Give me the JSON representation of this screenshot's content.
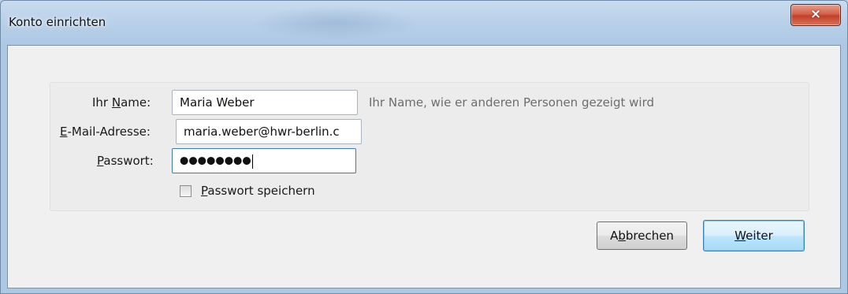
{
  "window": {
    "title": "Konto einrichten",
    "close_glyph": "×"
  },
  "form": {
    "name": {
      "label_pre": "Ihr ",
      "label_mnemonic": "N",
      "label_post": "ame:",
      "value": "Maria Weber",
      "hint": "Ihr Name, wie er anderen Personen gezeigt wird"
    },
    "email": {
      "label_mnemonic": "E",
      "label_post": "-Mail-Adresse:",
      "value": "maria.weber@hwr-berlin.c"
    },
    "password": {
      "label_mnemonic": "P",
      "label_post": "asswort:",
      "masked_value": "●●●●●●●●"
    },
    "remember": {
      "label_mnemonic": "P",
      "label_post": "asswort speichern",
      "checked": false
    }
  },
  "buttons": {
    "cancel": {
      "label_pre": "A",
      "label_mnemonic": "b",
      "label_post": "brechen"
    },
    "next": {
      "label_mnemonic": "W",
      "label_post": "eiter"
    }
  },
  "colors": {
    "title_bar": "#b7cfe8",
    "client_bg": "#f0f0f0",
    "close_button": "#c2402a",
    "default_button": "#bee6fd",
    "hint_text": "#6d6d6d"
  },
  "icons": {
    "close": "close-icon"
  }
}
